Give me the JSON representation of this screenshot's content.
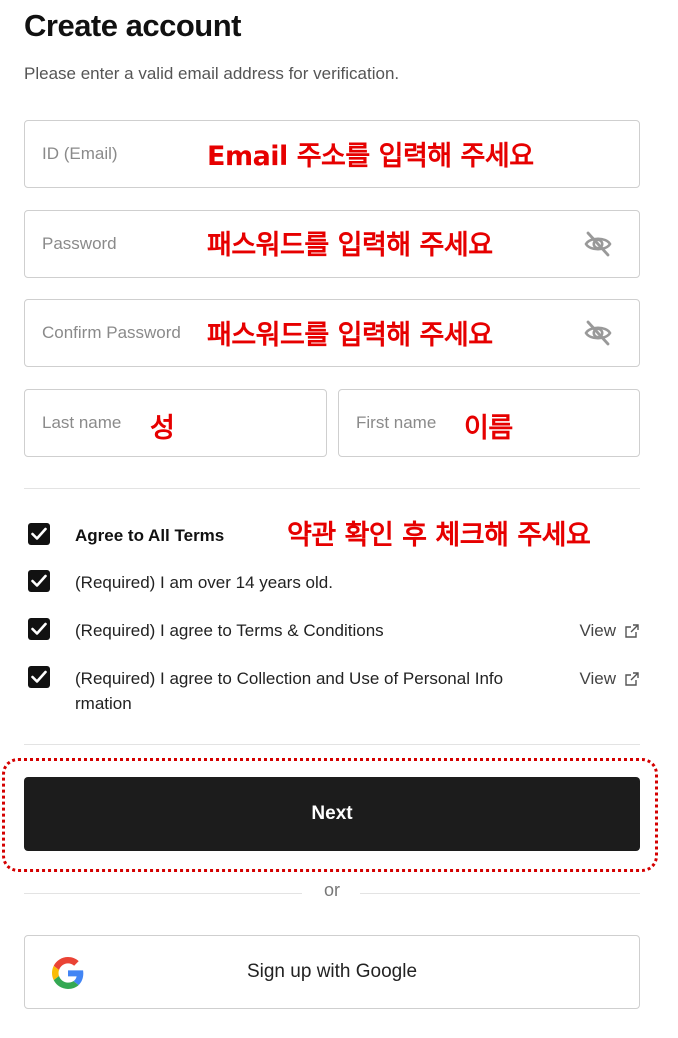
{
  "header": {
    "title": "Create account",
    "subtitle": "Please enter a valid email address for verification."
  },
  "form": {
    "email": {
      "placeholder": "ID (Email)",
      "annotation": "Email 주소를 입력해 주세요"
    },
    "password": {
      "placeholder": "Password",
      "annotation": "패스워드를 입력해 주세요",
      "icon": "eye-off-icon"
    },
    "confirm_password": {
      "placeholder": "Confirm Password",
      "annotation": "패스워드를 입력해 주세요",
      "icon": "eye-off-icon"
    },
    "last_name": {
      "placeholder": "Last name",
      "annotation": "성"
    },
    "first_name": {
      "placeholder": "First name",
      "annotation": "이름"
    }
  },
  "terms": {
    "annotation": "약관 확인 후 체크해 주세요",
    "items": [
      {
        "label": "Agree to All Terms",
        "checked": true
      },
      {
        "label": "(Required) I am over 14 years old.",
        "checked": true
      },
      {
        "label": "(Required) I agree to Terms & Conditions",
        "checked": true,
        "link": "View"
      },
      {
        "label_line1": "(Required) I agree to Collection and Use of Personal Info",
        "label_line2": "rmation",
        "checked": true,
        "link": "View"
      }
    ]
  },
  "actions": {
    "next_label": "Next",
    "or_label": "or",
    "google_label": "Sign up with Google"
  },
  "colors": {
    "annotation_red": "#e60000",
    "button_dark": "#1c1c1c"
  }
}
